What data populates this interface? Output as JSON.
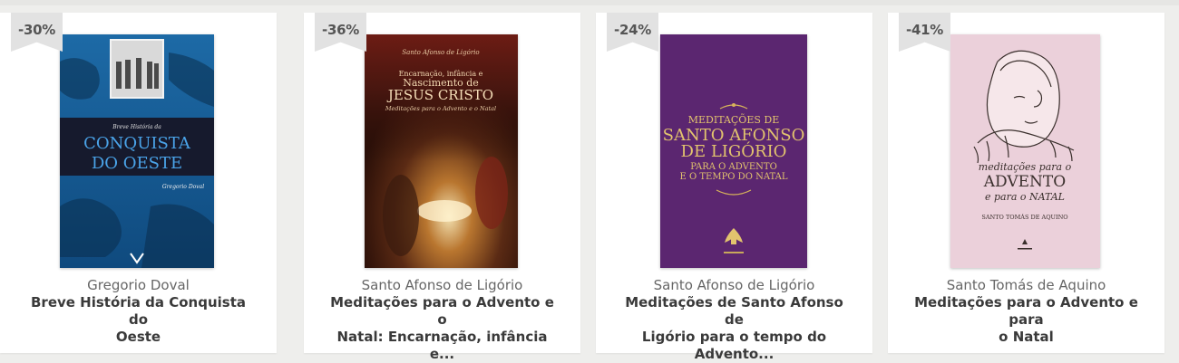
{
  "products": [
    {
      "discount": "-36%",
      "author": "Santo Afonso de Ligório",
      "title_line1": "Meditações para o Advento e o",
      "title_line2": "Natal: Encarnação, infância e...",
      "cover": {
        "top_author": "Santo Afonso de Ligório",
        "line1": "Encarnação, infância e",
        "line2": "Nascimento de",
        "line3": "JESUS CRISTO",
        "line4": "Meditações para o Advento e o Natal"
      }
    },
    {
      "discount": "-24%",
      "author": "Santo Afonso de Ligório",
      "title_line1": "Meditações de Santo Afonso de",
      "title_line2": "Ligório para o tempo do Advento...",
      "cover": {
        "line1": "MEDITAÇÕES DE",
        "line2": "SANTO AFONSO",
        "line3": "DE LIGÓRIO",
        "line4": "PARA O ADVENTO",
        "line5": "E O TEMPO DO NATAL"
      }
    },
    {
      "discount": "-41%",
      "author": "Santo Tomás de Aquino",
      "title_line1": "Meditações para o Advento e para",
      "title_line2": "o Natal",
      "cover": {
        "line1": "meditações para o",
        "line2": "ADVENTO",
        "line3": "e para o NATAL",
        "line4": "SANTO TOMÁS DE AQUINO"
      }
    },
    {
      "discount": "-30%",
      "author": "Gregorio Doval",
      "title_line1": "Breve História da Conquista do",
      "title_line2": "Oeste",
      "cover": {
        "small": "Breve História da",
        "line1": "CONQUISTA",
        "line2": "DO OESTE",
        "author": "Gregorio Doval"
      }
    }
  ],
  "colors": {
    "page_bg": "#eeeeec",
    "card_bg": "#ffffff",
    "badge_bg": "#e2e2e2",
    "title_text": "#3a3a3a",
    "author_text": "#666666"
  }
}
